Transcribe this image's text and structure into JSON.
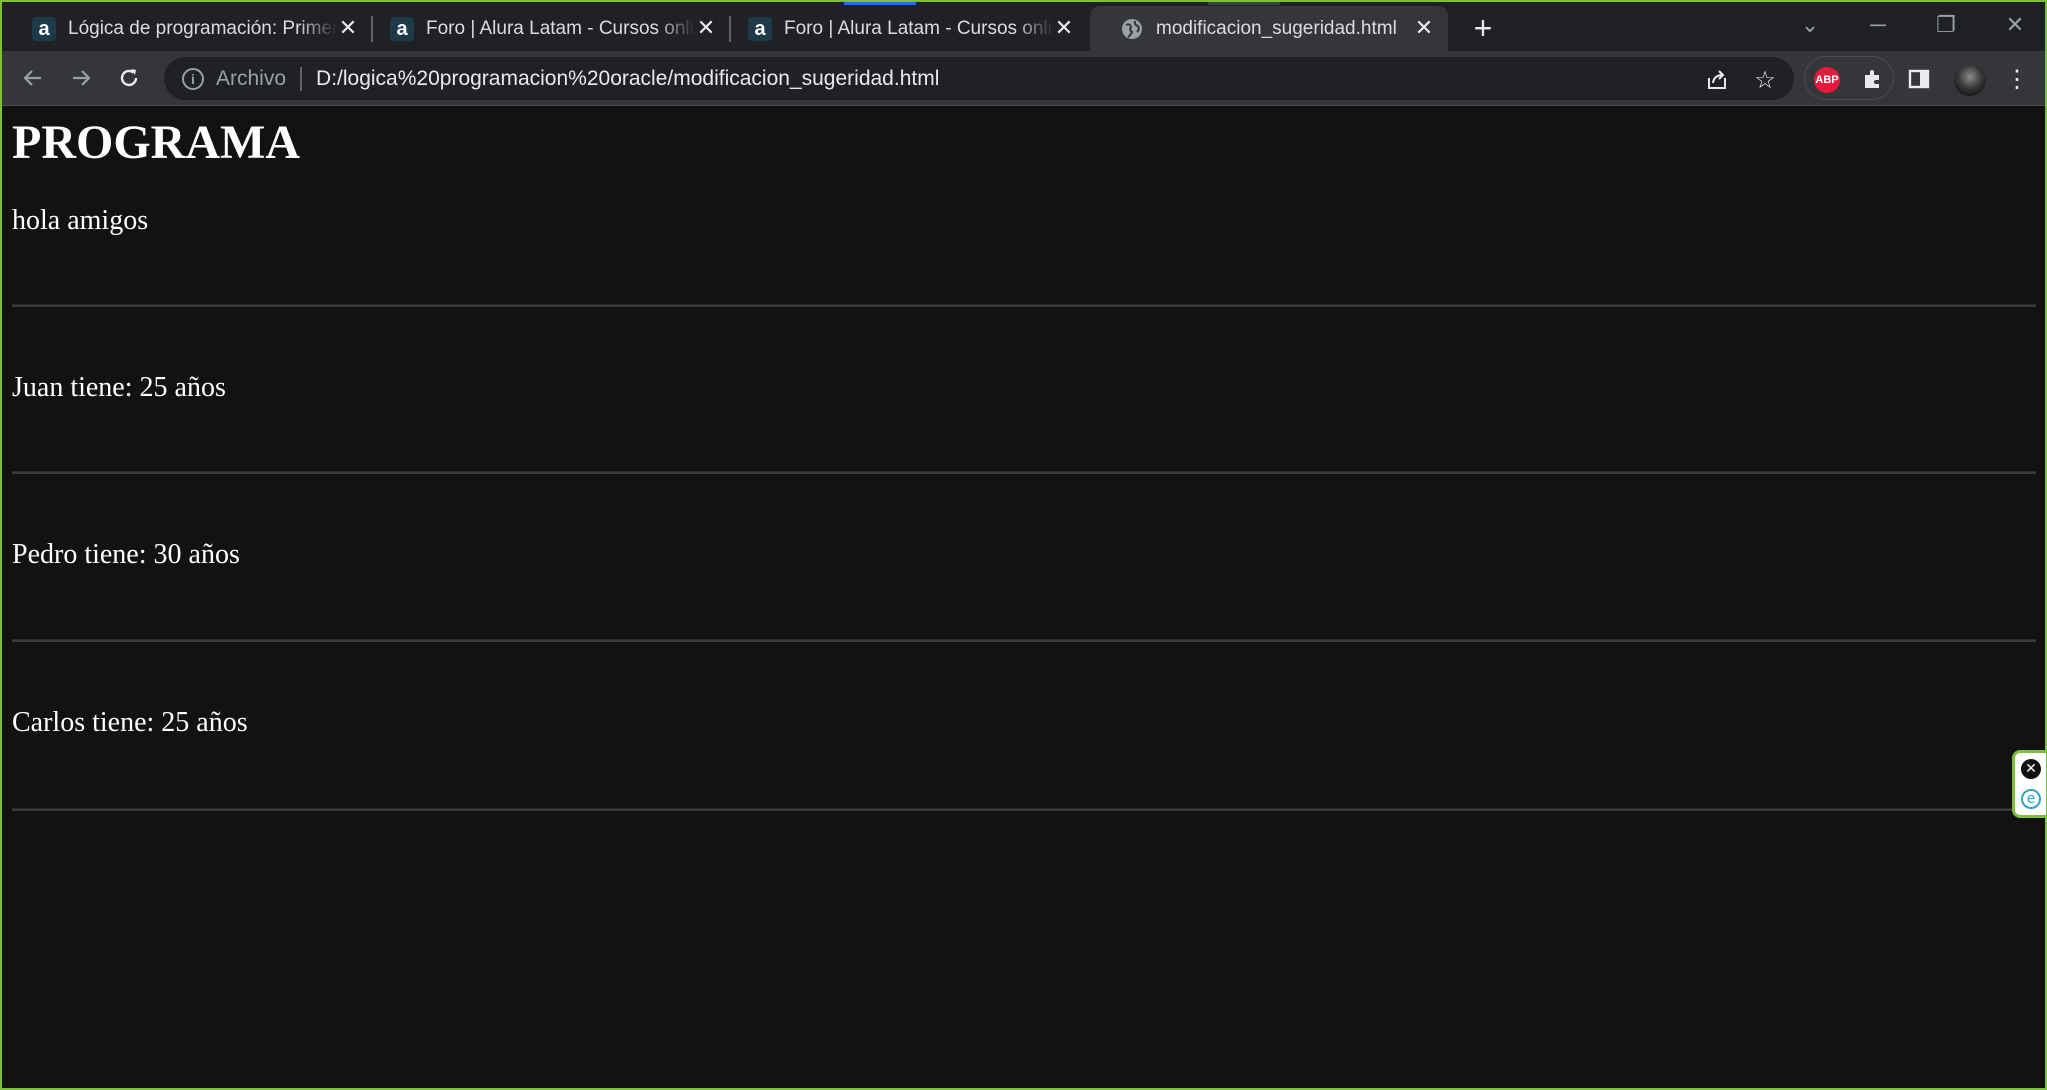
{
  "browser": {
    "tabs": [
      {
        "title": "Lógica de programación: Primeros pasos",
        "favicon": "alura-icon",
        "active": false
      },
      {
        "title": "Foro | Alura Latam - Cursos online",
        "favicon": "alura-icon",
        "active": false
      },
      {
        "title": "Foro | Alura Latam - Cursos online",
        "favicon": "alura-icon",
        "active": false
      },
      {
        "title": "modificacion_sugeridad.html",
        "favicon": "globe-icon",
        "active": true
      }
    ],
    "address": {
      "scheme_label": "Archivo",
      "url": "D:/logica%20programacion%20oracle/modificacion_sugeridad.html"
    },
    "extensions": {
      "adblock_label": "ABP"
    }
  },
  "page": {
    "title": "PROGRAMA",
    "greeting": "hola amigos",
    "lines": [
      "Juan tiene: 25 años",
      "Pedro tiene: 30 años",
      "Carlos tiene: 25 años"
    ]
  },
  "colors": {
    "page_bg": "#121212",
    "window_border": "#7bbf3a",
    "tab_active": "#35363a",
    "tabstrip": "#202124"
  }
}
